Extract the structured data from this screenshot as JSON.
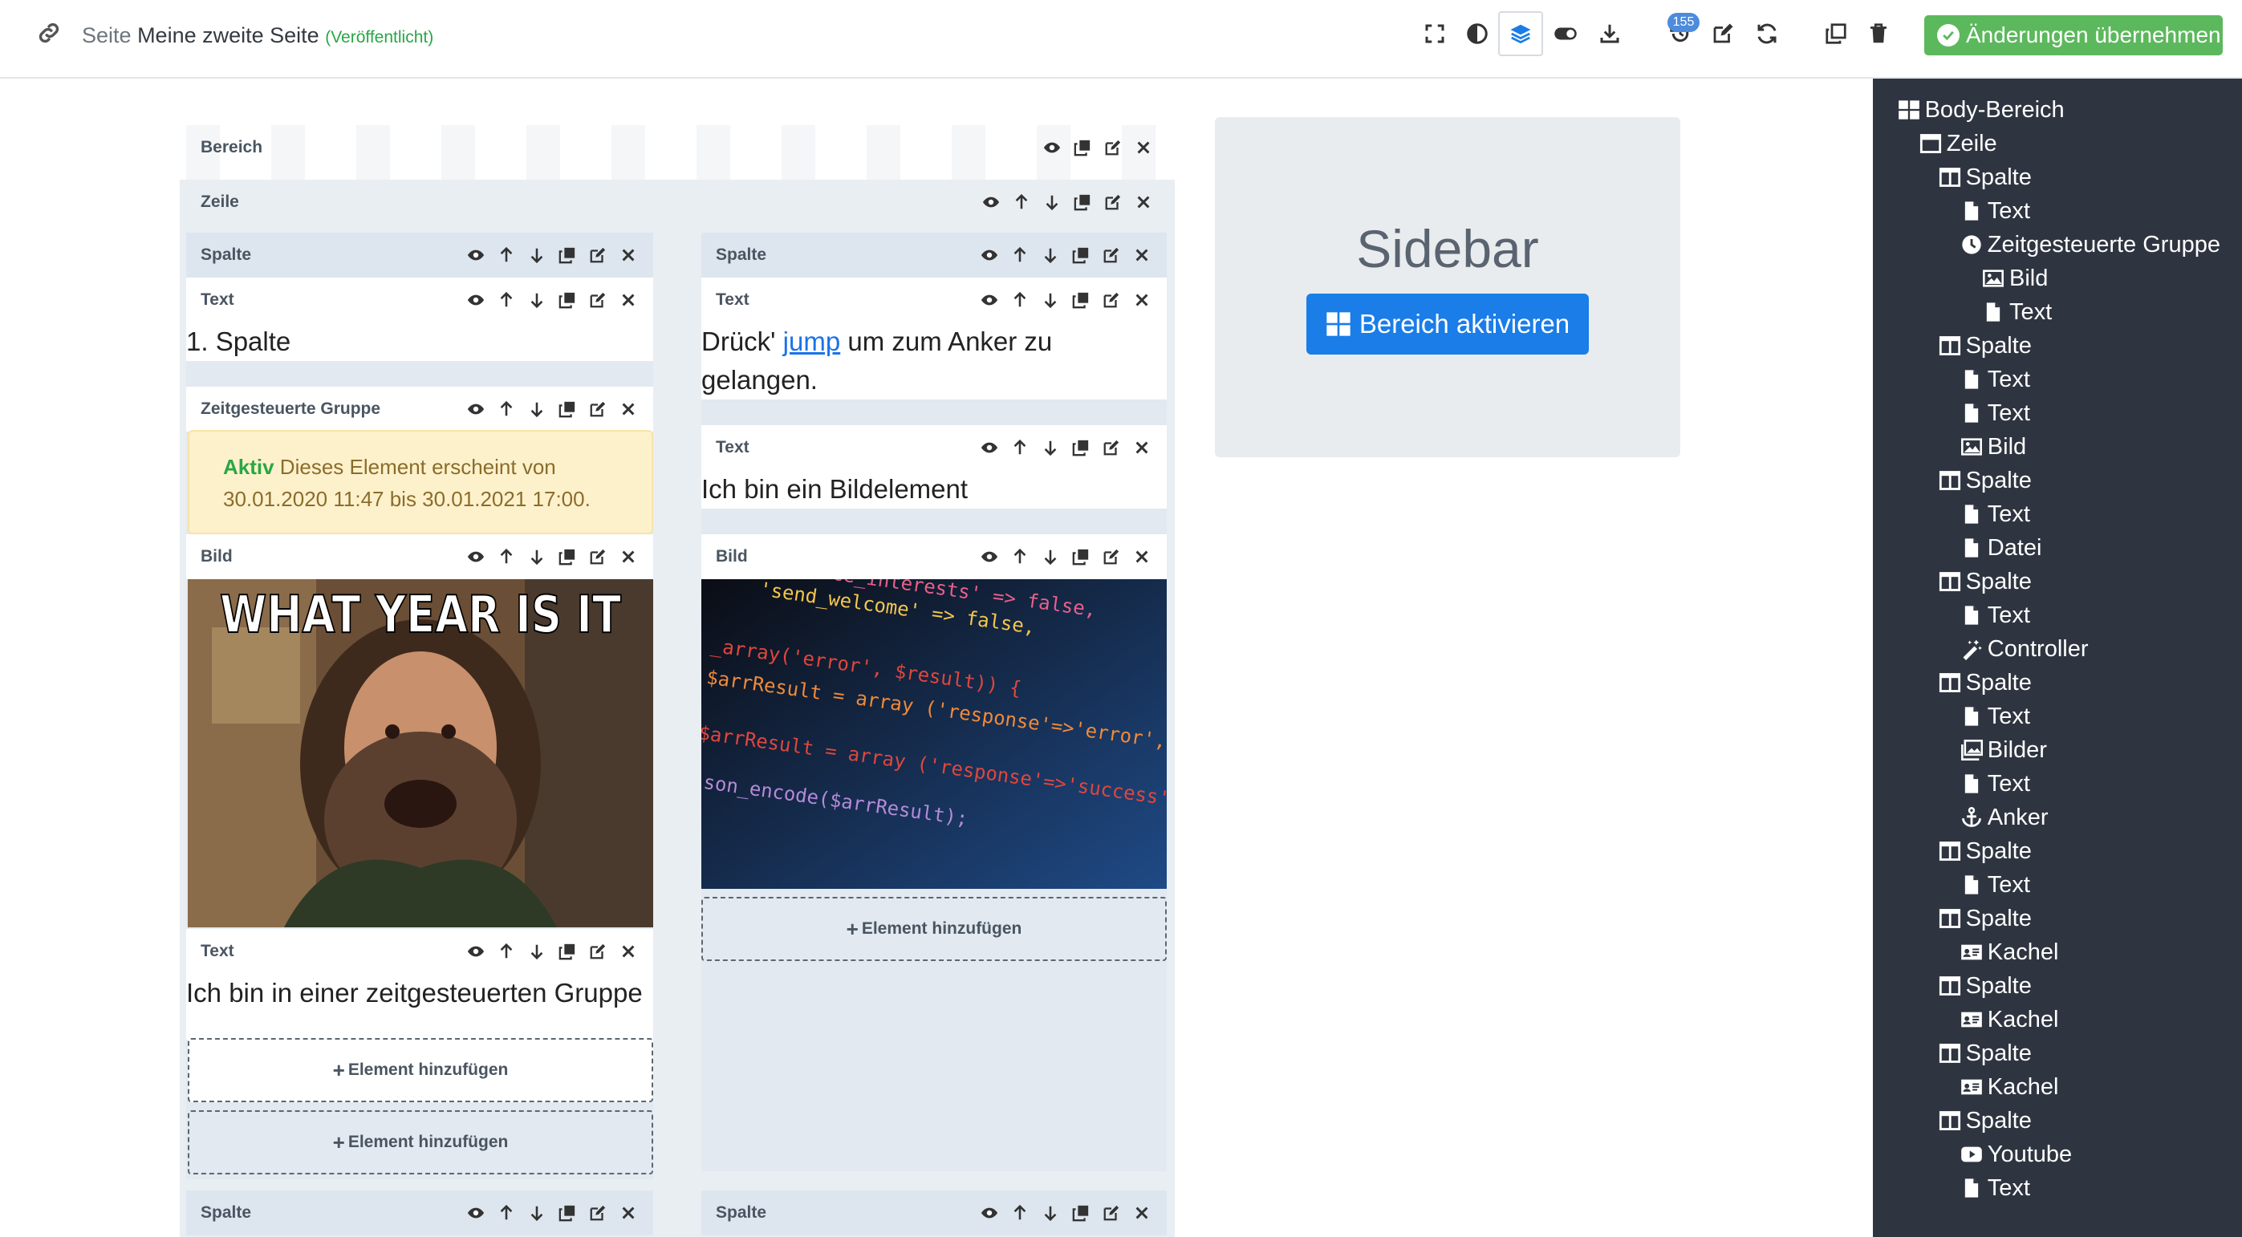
{
  "header": {
    "page_prefix": "Seite",
    "page_name": "Meine zweite Seite",
    "page_status": "(Veröffentlicht)",
    "history_count": "155",
    "apply_label": "Änderungen übernehmen",
    "icons": [
      "link-icon",
      "fullscreen-icon",
      "contrast-icon",
      "layers-icon",
      "toggle-icon",
      "download-icon",
      "history-icon",
      "edit-icon",
      "refresh-icon",
      "copy-icon",
      "trash-icon"
    ]
  },
  "editor": {
    "bereich_label": "Bereich",
    "zeile_label": "Zeile",
    "col1": {
      "spalte_label": "Spalte",
      "text1_label": "Text",
      "text1_content": "1. Spalte",
      "group_label": "Zeitgesteuerte Gruppe",
      "alert_aktiv": "Aktiv",
      "alert_line1": " Dieses Element erscheint von",
      "alert_line2": "30.01.2020 11:47 bis 30.01.2021 17:00.",
      "bild_label": "Bild",
      "meme_caption": "WHAT YEAR IS IT",
      "text2_label": "Text",
      "text2_content": "Ich bin in einer zeitgesteuerten Gruppe",
      "add_inner": "Element hinzufügen",
      "add_outer": "Element hinzufügen"
    },
    "col2": {
      "spalte_label": "Spalte",
      "text1_label": "Text",
      "text1_before": "Drück' ",
      "text1_link": "jump",
      "text1_after": " um zum Anker zu",
      "text1_line2": "gelangen.",
      "text2_label": "Text",
      "text2_content": "Ich bin ein Bildelement",
      "bild_label": "Bild",
      "code_lines": [
        "'replace_interests' => false,",
        "'send_welcome'      => false,",
        "_array('error', $result)) {",
        "$arrResult = array ('response'=>'error','message'",
        "$arrResult = array ('response'=>'success');",
        "json_encode($arrResult);"
      ],
      "add_label": "Element hinzufügen"
    },
    "col3_label": "Spalte",
    "col4_label": "Spalte"
  },
  "sidebar": {
    "title": "Sidebar",
    "button_label": "Bereich aktivieren"
  },
  "tree": [
    {
      "label": "Body-Bereich",
      "icon": "grid-icon",
      "level": 0
    },
    {
      "label": "Zeile",
      "icon": "window-icon",
      "level": 1
    },
    {
      "label": "Spalte",
      "icon": "columns-icon",
      "level": 2
    },
    {
      "label": "Text",
      "icon": "file-icon",
      "level": 3
    },
    {
      "label": "Zeitgesteuerte Gruppe",
      "icon": "clock-icon",
      "level": 3
    },
    {
      "label": "Bild",
      "icon": "image-icon",
      "level": 4
    },
    {
      "label": "Text",
      "icon": "file-icon",
      "level": 4
    },
    {
      "label": "Spalte",
      "icon": "columns-icon",
      "level": 2
    },
    {
      "label": "Text",
      "icon": "file-icon",
      "level": 3
    },
    {
      "label": "Text",
      "icon": "file-icon",
      "level": 3
    },
    {
      "label": "Bild",
      "icon": "image-icon",
      "level": 3
    },
    {
      "label": "Spalte",
      "icon": "columns-icon",
      "level": 2
    },
    {
      "label": "Text",
      "icon": "file-icon",
      "level": 3
    },
    {
      "label": "Datei",
      "icon": "file-icon",
      "level": 3
    },
    {
      "label": "Spalte",
      "icon": "columns-icon",
      "level": 2
    },
    {
      "label": "Text",
      "icon": "file-icon",
      "level": 3
    },
    {
      "label": "Controller",
      "icon": "magic-icon",
      "level": 3
    },
    {
      "label": "Spalte",
      "icon": "columns-icon",
      "level": 2
    },
    {
      "label": "Text",
      "icon": "file-icon",
      "level": 3
    },
    {
      "label": "Bilder",
      "icon": "images-icon",
      "level": 3
    },
    {
      "label": "Text",
      "icon": "file-icon",
      "level": 3
    },
    {
      "label": "Anker",
      "icon": "anchor-icon",
      "level": 3
    },
    {
      "label": "Spalte",
      "icon": "columns-icon",
      "level": 2
    },
    {
      "label": "Text",
      "icon": "file-icon",
      "level": 3
    },
    {
      "label": "Spalte",
      "icon": "columns-icon",
      "level": 2
    },
    {
      "label": "Kachel",
      "icon": "id-card-icon",
      "level": 3
    },
    {
      "label": "Spalte",
      "icon": "columns-icon",
      "level": 2
    },
    {
      "label": "Kachel",
      "icon": "id-card-icon",
      "level": 3
    },
    {
      "label": "Spalte",
      "icon": "columns-icon",
      "level": 2
    },
    {
      "label": "Kachel",
      "icon": "id-card-icon",
      "level": 3
    },
    {
      "label": "Spalte",
      "icon": "columns-icon",
      "level": 2
    },
    {
      "label": "Youtube",
      "icon": "youtube-icon",
      "level": 3
    },
    {
      "label": "Text",
      "icon": "file-icon",
      "level": 3
    }
  ],
  "colors": {
    "accent": "#1a7de8",
    "success": "#5cb85c",
    "tree_bg": "#2f3540",
    "alert_bg": "#fdf1cc"
  }
}
